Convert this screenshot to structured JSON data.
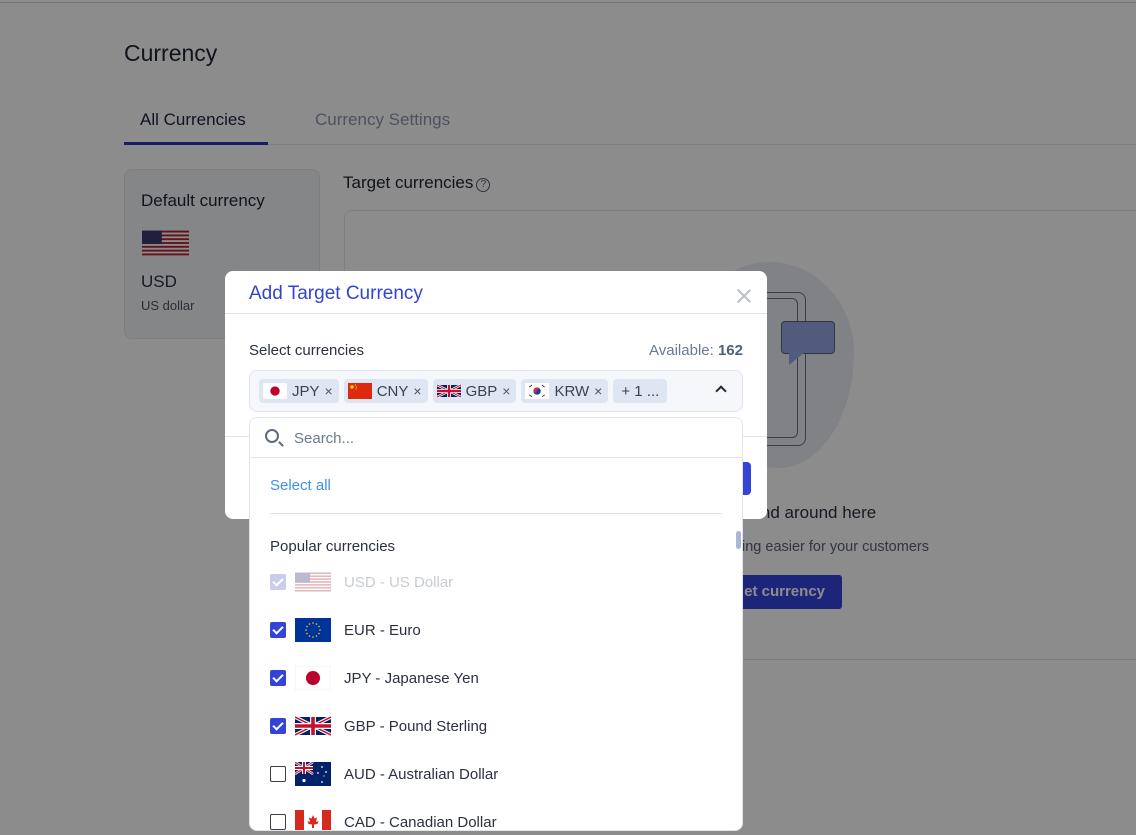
{
  "page": {
    "title": "Currency",
    "tabs": [
      {
        "label": "All Currencies",
        "active": true
      },
      {
        "label": "Currency Settings",
        "active": false
      }
    ],
    "default_currency": {
      "label": "Default currency",
      "flag": "us-flag",
      "code": "USD",
      "name": "US dollar"
    },
    "target_currencies": {
      "label": "Target currencies",
      "help_icon": "question-circle-icon",
      "empty_title_visible": "ound around here",
      "empty_subtitle_visible": "ing easier for your customers",
      "add_button_visible": "et currency"
    }
  },
  "modal": {
    "title": "Add Target Currency",
    "close_icon": "close-icon",
    "field_label": "Select currencies",
    "available_label": "Available:",
    "available_count": "162",
    "selected_chips": [
      {
        "code": "JPY",
        "flag": "jp-flag",
        "remove": "×"
      },
      {
        "code": "CNY",
        "flag": "cn-flag",
        "remove": "×"
      },
      {
        "code": "GBP",
        "flag": "gb-flag",
        "remove": "×"
      },
      {
        "code": "KRW",
        "flag": "kr-flag",
        "remove": "×"
      }
    ],
    "more_chip": "+ 1 ...",
    "toggle_icon": "chevron-up-icon"
  },
  "dropdown": {
    "search_placeholder": "Search...",
    "search_value": "",
    "select_all": "Select all",
    "group_label": "Popular currencies",
    "options": [
      {
        "label": "USD - US Dollar",
        "flag": "us-flag",
        "checked": true,
        "disabled": true
      },
      {
        "label": "EUR - Euro",
        "flag": "eu-flag",
        "checked": true,
        "disabled": false
      },
      {
        "label": "JPY - Japanese Yen",
        "flag": "jp-flag",
        "checked": true,
        "disabled": false
      },
      {
        "label": "GBP - Pound Sterling",
        "flag": "gb-flag",
        "checked": true,
        "disabled": false
      },
      {
        "label": "AUD - Australian Dollar",
        "flag": "au-flag",
        "checked": false,
        "disabled": false
      },
      {
        "label": "CAD - Canadian Dollar",
        "flag": "ca-flag",
        "checked": false,
        "disabled": false
      }
    ]
  },
  "colors": {
    "accent": "#3443d8",
    "link": "#3d8ef0",
    "modal_title": "#3443d2",
    "chip_bg": "#dfe6f3"
  }
}
